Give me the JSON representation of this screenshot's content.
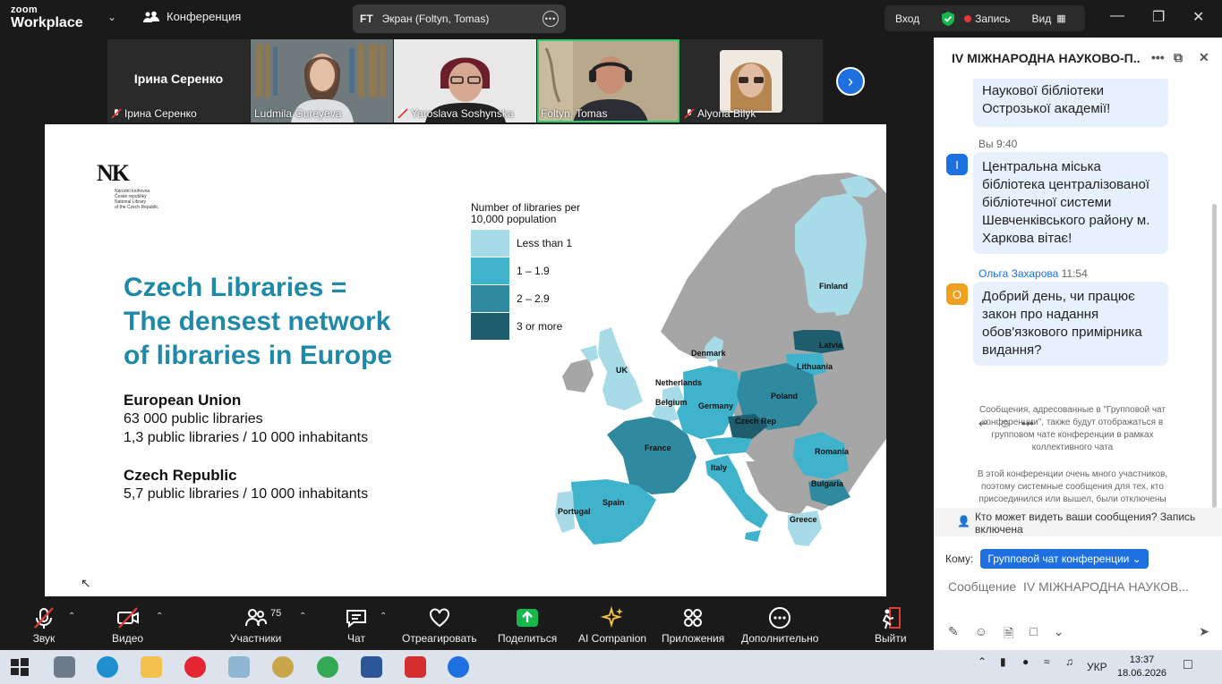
{
  "window": {
    "logo_line1": "zoom",
    "logo_line2": "Workplace",
    "conference_label": "Конференция",
    "share_initials": "FT",
    "share_label": "Экран (Foltyn, Tomas)",
    "signin_label": "Вход",
    "record_label": "Запись",
    "view_label": "Вид"
  },
  "participants": [
    {
      "name": "Ірина Серенко",
      "center_label": "Ірина Серенко",
      "muted": true,
      "video": false
    },
    {
      "name": "Ludmila Gureyeva",
      "muted": false,
      "video": true
    },
    {
      "name": "Yaroslava Soshynska",
      "muted": true,
      "video": true
    },
    {
      "name": "Foltyn, Tomas",
      "muted": false,
      "video": true,
      "active": true
    },
    {
      "name": "Alyona Bilyk",
      "muted": true,
      "video": true
    }
  ],
  "slide": {
    "logo_mark": "NK",
    "logo_sub": [
      "Národní knihovna",
      "České republiky",
      "National Library",
      "of the Czech Republic"
    ],
    "title_lines": [
      "Czech Libraries =",
      "The densest network",
      "of libraries in Europe"
    ],
    "eu_heading": "European Union",
    "eu_line1": "63 000 public libraries",
    "eu_line2": "1,3 public libraries / 10 000 inhabitants",
    "cz_heading": "Czech Republic",
    "cz_line1": "5,7 public libraries / 10 000 inhabitants",
    "legend_title_line1": "Number of libraries per",
    "legend_title_line2": "10,000 population",
    "legend": [
      {
        "label": "Less than 1",
        "color": "#a8dbe8"
      },
      {
        "label": "1 – 1.9",
        "color": "#3fb3cc"
      },
      {
        "label": "2 – 2.9",
        "color": "#2f8aa0"
      },
      {
        "label": "3 or more",
        "color": "#1d5d6e"
      }
    ],
    "countries": {
      "finland": "Finland",
      "latvia": "Latvia",
      "lithuania": "Lithuania",
      "denmark": "Denmark",
      "uk": "UK",
      "netherlands": "Netherlands",
      "belgium": "Belgium",
      "germany": "Germany",
      "poland": "Poland",
      "czech": "Czech Rep",
      "france": "France",
      "romania": "Romania",
      "italy": "Italy",
      "bulgaria": "Bulgaria",
      "spain": "Spain",
      "portugal": "Portugal",
      "greece": "Greece"
    }
  },
  "chat": {
    "title": "IV МІЖНАРОДНА НАУКОВО-П...",
    "msg0_text": "Наукової бібліотеки Острозької академії!",
    "msg1_sender": "Вы",
    "msg1_time": "9:40",
    "msg1_avatar": "I",
    "msg1_text": "Центральна міська бібліотека централізованої бібліотечної системи Шевченківського району м. Харкова вітає!",
    "msg2_sender": "Ольга Захарова",
    "msg2_time": "11:54",
    "msg2_avatar": "О",
    "msg2_text": "Добрий день, чи працює закон про надання обов'язкового примірника видання?",
    "sys1": "Сообщения, адресованные в \"Групповой чат конференции\", также будут отображаться в групповом чате конференции в рамках коллективного чата",
    "sys2": "В этой конференции очень много участников, поэтому системные сообщения для тех, кто присоединился или вышел, были отключены",
    "who_can_see": "Кто может видеть ваши сообщения? Запись включена",
    "to_label": "Кому:",
    "to_value": "Групповой чат конференции",
    "input_placeholder": "Сообщение  IV МІЖНАРОДНА НАУКОВ..."
  },
  "toolbar": {
    "audio": "Звук",
    "video": "Видео",
    "participants": "Участники",
    "participants_count": "75",
    "chat": "Чат",
    "react": "Отреагировать",
    "share": "Поделиться",
    "ai": "AI Companion",
    "apps": "Приложения",
    "more": "Дополнительно",
    "leave": "Выйти"
  },
  "taskbar": {
    "lang": "УКР",
    "time": "13:37",
    "date": "18.06.2026"
  },
  "colors": {
    "accent": "#1e6fe0",
    "slide_title": "#1f8aa8",
    "active_speaker": "#2ecc71",
    "share_green": "#16b84d",
    "map_grey": "#a6a6a6"
  }
}
